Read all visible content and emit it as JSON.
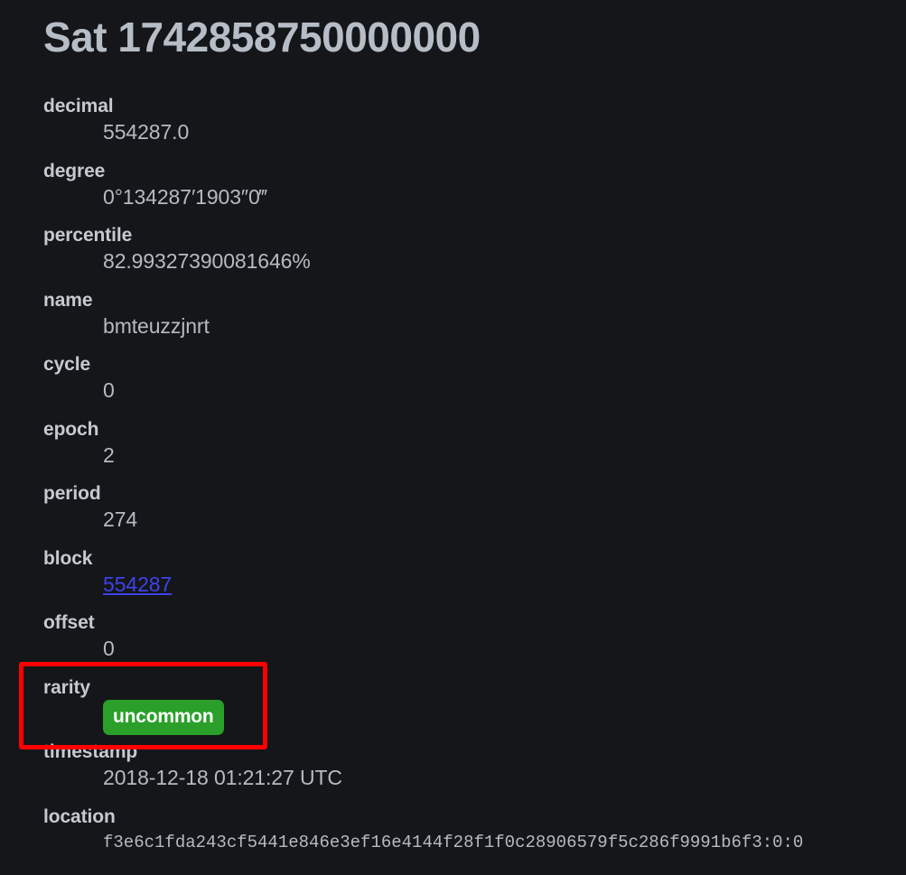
{
  "page": {
    "title": "Sat 1742858750000000",
    "background_color": "#141619",
    "label_color": "#c5cad0",
    "value_color": "#b5bbc2",
    "link_color": "#3d43ea",
    "badge_color": "#2aa02a",
    "highlight_color": "#ff0000"
  },
  "fields": [
    {
      "label": "decimal",
      "value": "554287.0"
    },
    {
      "label": "degree",
      "value": "0°134287′1903″0‴"
    },
    {
      "label": "percentile",
      "value": "82.99327390081646%"
    },
    {
      "label": "name",
      "value": "bmteuzzjnrt"
    },
    {
      "label": "cycle",
      "value": "0"
    },
    {
      "label": "epoch",
      "value": "2"
    },
    {
      "label": "period",
      "value": "274"
    },
    {
      "label": "block",
      "value": "554287"
    },
    {
      "label": "offset",
      "value": "0"
    },
    {
      "label": "rarity",
      "value": "uncommon"
    },
    {
      "label": "timestamp",
      "value": "2018-12-18 01:21:27 UTC"
    },
    {
      "label": "location",
      "value": "f3e6c1fda243cf5441e846e3ef16e4144f28f1f0c28906579f5c286f9991b6f3:0:0"
    }
  ]
}
